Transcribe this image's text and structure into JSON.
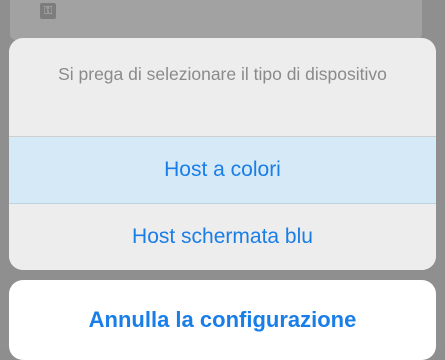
{
  "action_sheet": {
    "message": "Si prega di selezionare il tipo di dispositivo",
    "actions": [
      {
        "label": "Host a colori",
        "highlighted": true
      },
      {
        "label": "Host schermata blu",
        "highlighted": false
      }
    ]
  },
  "cancel_button": {
    "label": "Annulla la configurazione"
  },
  "colors": {
    "accent": "#1a7ee8",
    "dimmed_backdrop": "#8f8f8f",
    "sheet_background": "#ededed",
    "highlight": "#d6e9f6"
  }
}
